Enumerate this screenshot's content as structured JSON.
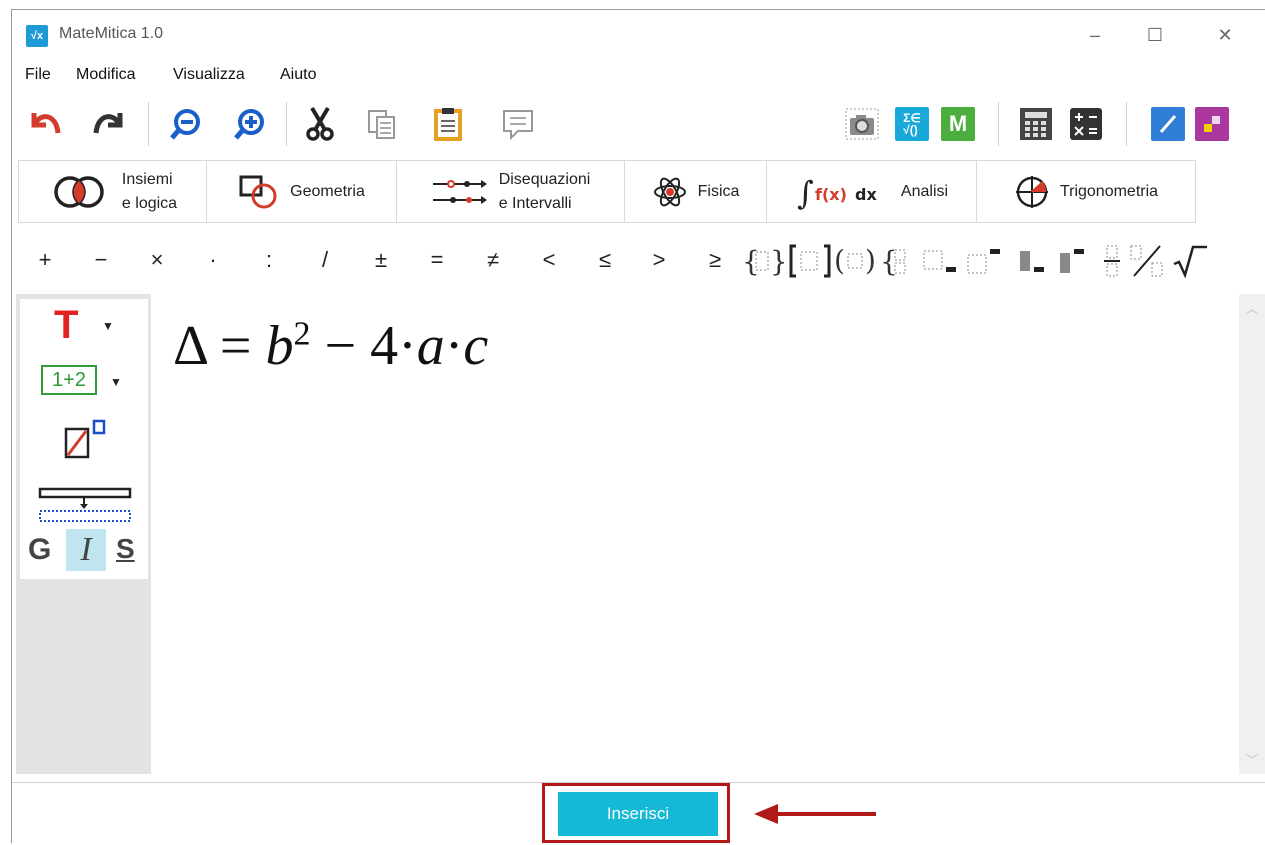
{
  "window": {
    "title": "MateMitica 1.0",
    "app_icon_text": "√x"
  },
  "menu": [
    "File",
    "Modifica",
    "Visualizza",
    "Aiuto"
  ],
  "tabs": [
    {
      "line1": "Insiemi",
      "line2": "e logica"
    },
    {
      "line1": "Geometria",
      "line2": ""
    },
    {
      "line1": "Disequazioni",
      "line2": "e Intervalli"
    },
    {
      "line1": "Fisica",
      "line2": ""
    },
    {
      "line1": "Analisi",
      "line2": ""
    },
    {
      "line1": "Trigonometria",
      "line2": ""
    }
  ],
  "symbols": [
    "+",
    "−",
    "×",
    "·",
    ":",
    "/",
    "±",
    "=",
    "≠",
    "<",
    "≤",
    ">",
    "≥"
  ],
  "sidebar": {
    "text_tool": "T",
    "number_tool": "1+2",
    "bold": "G",
    "italic": "I",
    "underline": "S"
  },
  "toolbar_apps": {
    "m_label": "M"
  },
  "formula": {
    "delta": "Δ",
    "equals": "=",
    "b": "b",
    "exp": "2",
    "minus": "−",
    "four": "4",
    "dot": "·",
    "a": "a",
    "c": "c"
  },
  "footer": {
    "insert_label": "Inserisci"
  },
  "colors": {
    "accent": "#14b9d6",
    "highlight": "#b21a1a"
  }
}
